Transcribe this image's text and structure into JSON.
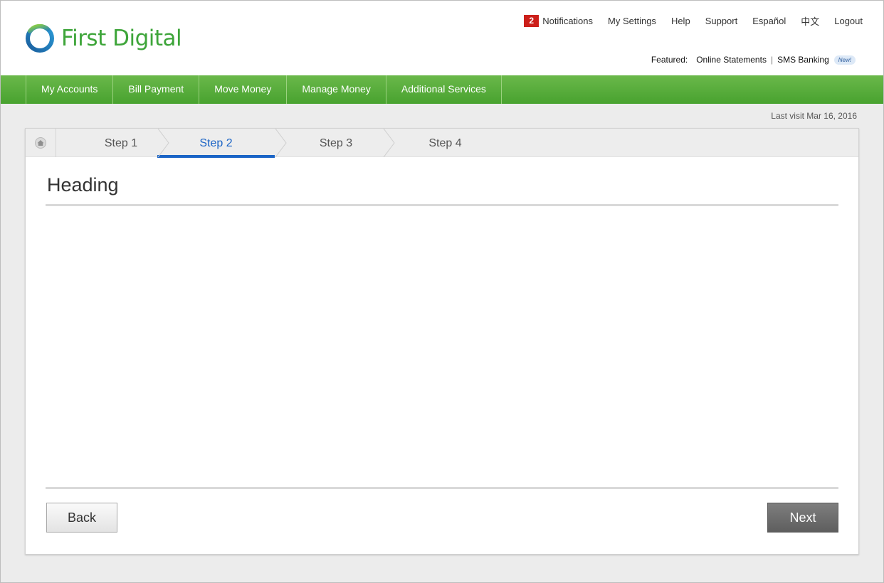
{
  "brand": {
    "name": "First Digital"
  },
  "utility_nav": {
    "notifications_count": "2",
    "notifications_label": "Notifications",
    "settings": "My Settings",
    "help": "Help",
    "support": "Support",
    "spanish": "Español",
    "chinese": "中文",
    "logout": "Logout"
  },
  "featured": {
    "label": "Featured:",
    "link1": "Online Statements",
    "separator": "|",
    "link2": "SMS Banking",
    "new_badge": "New!"
  },
  "main_nav": {
    "items": [
      {
        "label": "My Accounts"
      },
      {
        "label": "Bill Payment"
      },
      {
        "label": "Move Money"
      },
      {
        "label": "Manage Money"
      },
      {
        "label": "Additional Services"
      }
    ]
  },
  "last_visit": "Last visit Mar 16, 2016",
  "steps": {
    "items": [
      {
        "label": "Step 1"
      },
      {
        "label": "Step 2"
      },
      {
        "label": "Step 3"
      },
      {
        "label": "Step 4"
      }
    ],
    "active_index": 1
  },
  "content": {
    "heading": "Heading"
  },
  "actions": {
    "back": "Back",
    "next": "Next"
  },
  "colors": {
    "brand_green": "#48a22f",
    "accent_blue": "#1a64c6",
    "badge_red": "#cc1f1a"
  }
}
